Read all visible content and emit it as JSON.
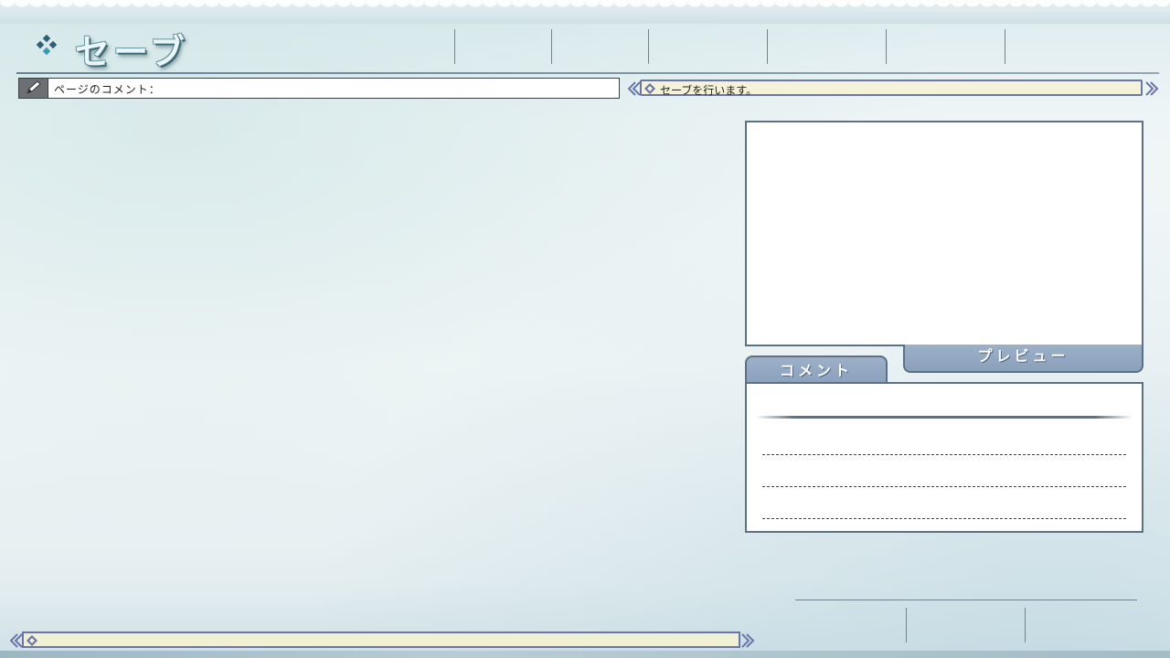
{
  "screen": {
    "title": "セーブ"
  },
  "page_comment": {
    "label": "ページのコメント："
  },
  "message_bar": {
    "text": "セーブを行います。"
  },
  "tabs": {
    "preview_label": "プレビュー",
    "comment_label": "コメント"
  },
  "bottom_bar": {
    "text": ""
  },
  "colors": {
    "panel_border": "#5b7188",
    "tab_fill": "#8aa0bc",
    "message_fill": "#f4f2d8",
    "message_border": "#6a76a8"
  },
  "icons": {
    "title": "diamond-cluster-icon",
    "page_comment": "pen-icon",
    "arrows": "double-chevron-icon"
  }
}
